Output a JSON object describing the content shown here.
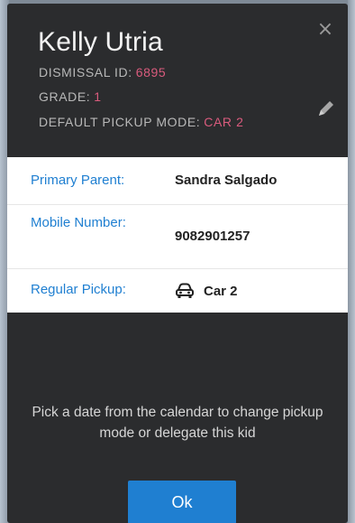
{
  "student": {
    "name": "Kelly Utria",
    "dismissal_id_label": "DISMISSAL ID:",
    "dismissal_id_value": "6895",
    "grade_label": "GRADE:",
    "grade_value": "1",
    "default_pickup_label": "DEFAULT PICKUP MODE:",
    "default_pickup_value": "CAR 2"
  },
  "details": {
    "primary_parent_label": "Primary Parent:",
    "primary_parent_value": "Sandra Salgado",
    "mobile_label": "Mobile Number:",
    "mobile_value": "9082901257",
    "regular_pickup_label": "Regular Pickup:",
    "regular_pickup_value": "Car 2"
  },
  "hint": "Pick a date from the calendar to change pickup mode or delegate this kid",
  "ok_label": "Ok",
  "icons": {
    "close": "close-icon",
    "edit": "pencil-icon",
    "car": "car-icon"
  },
  "colors": {
    "accent": "#1f7fd1",
    "modal_bg": "#2b2c2e",
    "meta_value": "#d95b7d"
  }
}
